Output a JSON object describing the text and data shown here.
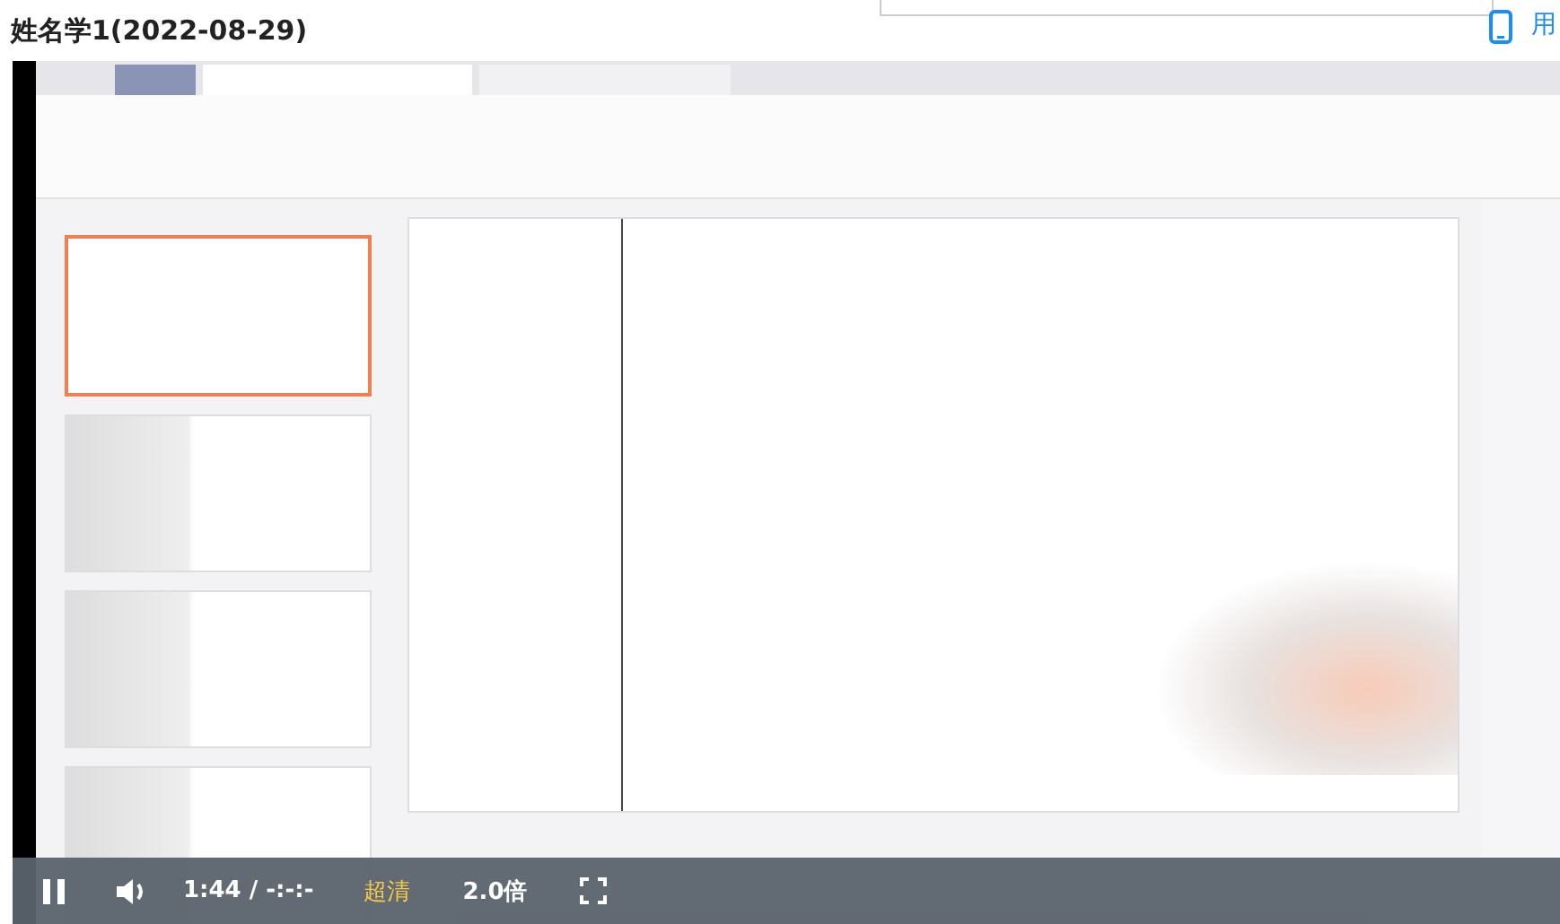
{
  "page": {
    "title": "姓名学1(2022-08-29)",
    "side_link": "用"
  },
  "player": {
    "playing": true,
    "time": "1:44 / -:-:-",
    "quality": "超清",
    "speed": "2.0倍"
  }
}
